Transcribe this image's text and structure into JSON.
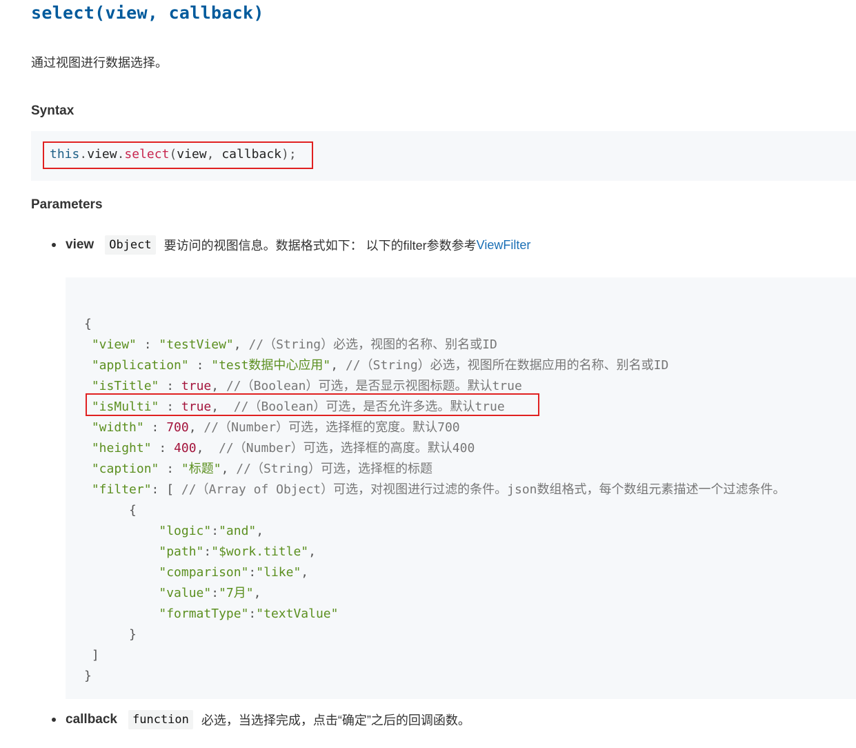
{
  "heading": "select(view, callback)",
  "description": "通过视图进行数据选择。",
  "syntax": {
    "title": "Syntax",
    "code": {
      "obj": "this",
      "dot1": ".",
      "prop": "view",
      "dot2": ".",
      "method": "select",
      "open": "(",
      "arg1": "view",
      "comma": ", ",
      "arg2": "callback",
      "close": ");"
    }
  },
  "parameters": {
    "title": "Parameters",
    "items": [
      {
        "name": "view",
        "type": "Object",
        "desc": "要访问的视图信息。数据格式如下： 以下的filter参数参考",
        "link": "ViewFilter"
      },
      {
        "name": "callback",
        "type": "function",
        "desc": "必选，当选择完成，点击“确定”之后的回调函数。"
      }
    ]
  },
  "code_block": {
    "open_brace": "{",
    "lines": [
      {
        "key": "\"view\"",
        "sep": " : ",
        "val": "\"testView\"",
        "vtype": "s",
        "after": ",",
        "comment": " //（String）必选，视图的名称、别名或ID"
      },
      {
        "key": "\"application\"",
        "sep": " : ",
        "val": "\"test数据中心应用\"",
        "vtype": "s",
        "after": ",",
        "comment": " //（String）必选，视图所在数据应用的名称、别名或ID"
      },
      {
        "key": "\"isTitle\"",
        "sep": " : ",
        "val": "true",
        "vtype": "b",
        "after": ",",
        "comment": " //（Boolean）可选，是否显示视图标题。默认true"
      },
      {
        "key": "\"isMulti\"",
        "sep": " : ",
        "val": "true",
        "vtype": "b",
        "after": ",",
        "comment": "  //（Boolean）可选，是否允许多选。默认true"
      },
      {
        "key": "\"width\"",
        "sep": " : ",
        "val": "700",
        "vtype": "n",
        "after": ",",
        "comment": " //（Number）可选，选择框的宽度。默认700"
      },
      {
        "key": "\"height\"",
        "sep": " : ",
        "val": "400",
        "vtype": "n",
        "after": ",",
        "comment": "  //（Number）可选，选择框的高度。默认400"
      },
      {
        "key": "\"caption\"",
        "sep": " : ",
        "val": "\"标题\"",
        "vtype": "s",
        "after": ",",
        "comment": " //（String）可选，选择框的标题"
      },
      {
        "key": "\"filter\"",
        "sep": ": ",
        "val": "[",
        "vtype": "p",
        "after": "",
        "comment": " //（Array of Object）可选，对视图进行过滤的条件。json数组格式，每个数组元素描述一个过滤条件。"
      }
    ],
    "inner_open": "{",
    "filter_items": [
      {
        "key": "\"logic\"",
        "val": "\"and\"",
        "after": ","
      },
      {
        "key": "\"path\"",
        "val": "\"$work.title\"",
        "after": ","
      },
      {
        "key": "\"comparison\"",
        "val": "\"like\"",
        "after": ","
      },
      {
        "key": "\"value\"",
        "val": "\"7月\"",
        "after": ","
      },
      {
        "key": "\"formatType\"",
        "val": "\"textValue\"",
        "after": ""
      }
    ],
    "inner_close": "}",
    "array_close": "]",
    "close_brace": "}"
  },
  "highlight_color": "#e02020"
}
